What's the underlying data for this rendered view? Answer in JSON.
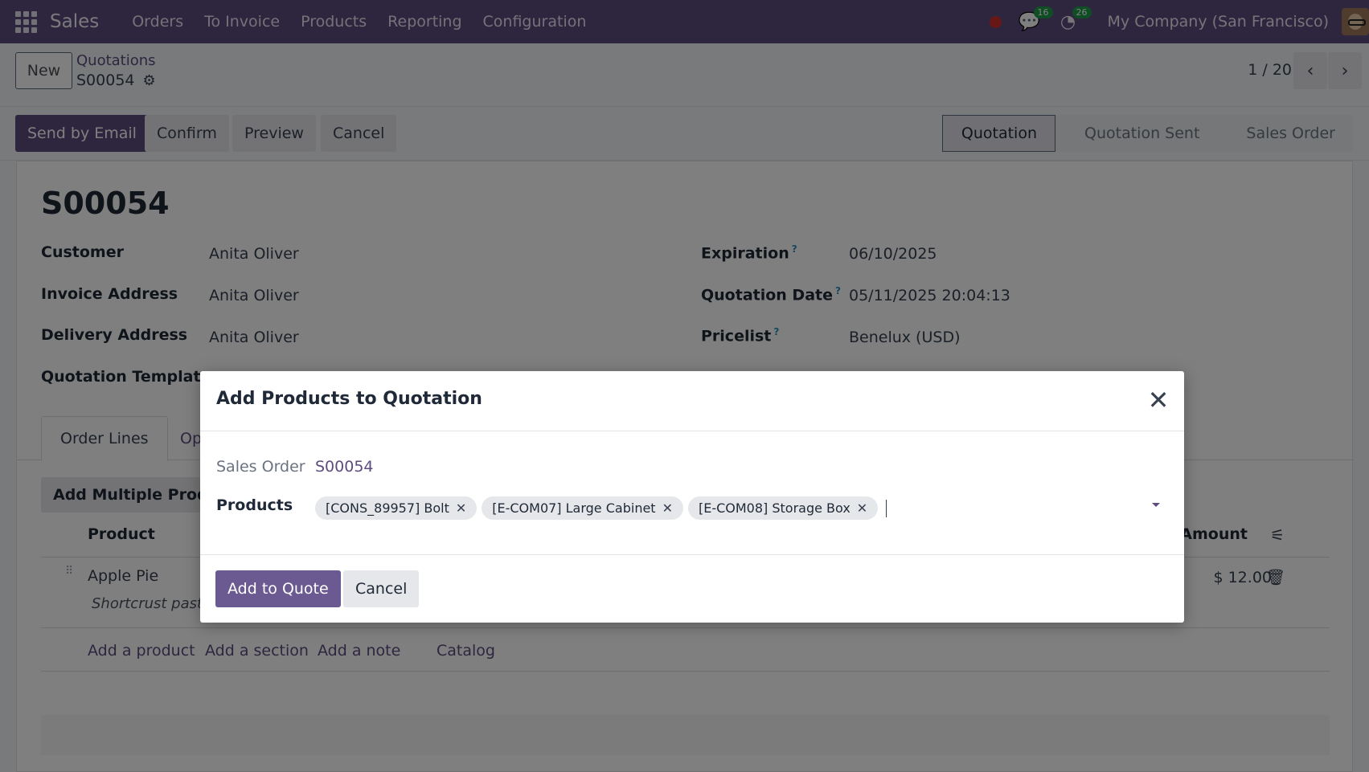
{
  "navbar": {
    "app_name": "Sales",
    "menu": [
      "Orders",
      "To Invoice",
      "Products",
      "Reporting",
      "Configuration"
    ],
    "messages_count": "16",
    "activities_count": "26",
    "company": "My Company (San Francisco)"
  },
  "control": {
    "new_label": "New",
    "breadcrumb": "Quotations",
    "record": "S00054",
    "pager": "1 / 20"
  },
  "actions": {
    "send_email": "Send by Email",
    "confirm": "Confirm",
    "preview": "Preview",
    "cancel": "Cancel"
  },
  "stages": [
    "Quotation",
    "Quotation Sent",
    "Sales Order"
  ],
  "form": {
    "title": "S00054",
    "customer_label": "Customer",
    "customer": "Anita Oliver",
    "invoice_label": "Invoice Address",
    "invoice": "Anita Oliver",
    "delivery_label": "Delivery Address",
    "delivery": "Anita Oliver",
    "template_label": "Quotation Template",
    "expiration_label": "Expiration",
    "expiration": "06/10/2025",
    "quote_date_label": "Quotation Date",
    "quote_date": "05/11/2025 20:04:13",
    "pricelist_label": "Pricelist",
    "pricelist": "Benelux (USD)",
    "help_mark": "?"
  },
  "tabs": {
    "order_lines": "Order Lines",
    "other_partial": "Op"
  },
  "lines": {
    "add_multi_partial": "Add Multiple Produc",
    "col_product": "Product",
    "col_amount": "Amount",
    "row1_name": "Apple Pie",
    "row1_desc_partial": "Shortcrust pastr",
    "row1_amount": "$ 12.00",
    "add_product": "Add a product",
    "add_section": "Add a section",
    "add_note": "Add a note",
    "catalog": "Catalog"
  },
  "modal": {
    "title": "Add Products to Quotation",
    "sales_order_label": "Sales Order",
    "sales_order_value": "S00054",
    "products_label": "Products",
    "tags": [
      "[CONS_89957] Bolt",
      "[E-COM07] Large Cabinet",
      "[E-COM08] Storage Box"
    ],
    "add_btn": "Add to Quote",
    "cancel_btn": "Cancel"
  },
  "colors": {
    "brand": "#5d4b7e",
    "badge": "#1f9b49"
  }
}
